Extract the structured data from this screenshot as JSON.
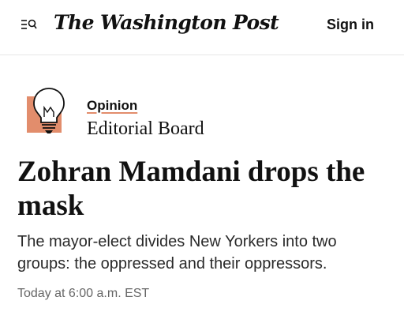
{
  "header": {
    "logo_text": "The Washington Post",
    "sign_in_label": "Sign in",
    "menu_icon": "menu-search-icon"
  },
  "article": {
    "section_label": "Opinion",
    "author_label": "Editorial Board",
    "section_icon": "lightbulb-icon",
    "headline": "Zohran Mamdani drops the mask",
    "dek": "The mayor-elect divides New Yorkers into two groups: the oppressed and their oppressors.",
    "timestamp": "Today at 6:00 a.m. EST"
  },
  "colors": {
    "accent": "#e28d6c",
    "text": "#111111",
    "muted": "#666666",
    "divider": "#e6e6e6"
  }
}
